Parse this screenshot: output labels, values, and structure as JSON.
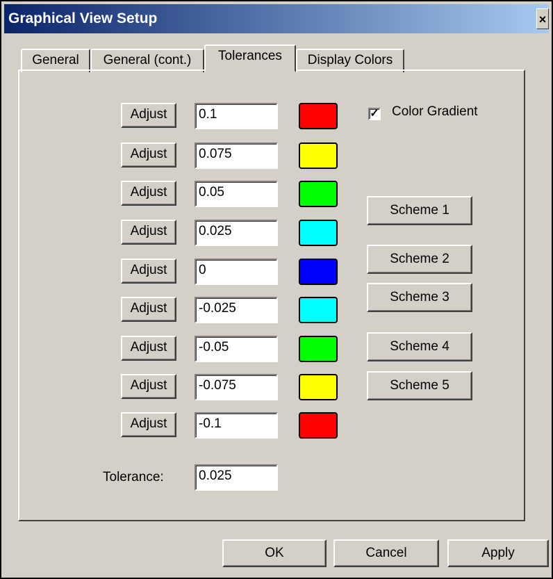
{
  "window": {
    "title": "Graphical View Setup",
    "close_label": "×"
  },
  "tabs": [
    {
      "label": "General",
      "active": false
    },
    {
      "label": "General (cont.)",
      "active": false
    },
    {
      "label": "Tolerances",
      "active": true
    },
    {
      "label": "Display Colors",
      "active": false
    }
  ],
  "tolerances": {
    "adjust_label": "Adjust",
    "rows": [
      {
        "value": "0.1",
        "color": "#ff0000"
      },
      {
        "value": "0.075",
        "color": "#ffff00"
      },
      {
        "value": "0.05",
        "color": "#00ff00"
      },
      {
        "value": "0.025",
        "color": "#00ffff"
      },
      {
        "value": "0",
        "color": "#0000ff"
      },
      {
        "value": "-0.025",
        "color": "#00ffff"
      },
      {
        "value": "-0.05",
        "color": "#00ff00"
      },
      {
        "value": "-0.075",
        "color": "#ffff00"
      },
      {
        "value": "-0.1",
        "color": "#ff0000"
      }
    ],
    "color_gradient": {
      "label": "Color Gradient",
      "checked": true
    },
    "schemes": [
      "Scheme 1",
      "Scheme 2",
      "Scheme 3",
      "Scheme 4",
      "Scheme 5"
    ],
    "tolerance_label": "Tolerance:",
    "tolerance_value": "0.025"
  },
  "footer": {
    "ok": "OK",
    "cancel": "Cancel",
    "apply": "Apply"
  }
}
